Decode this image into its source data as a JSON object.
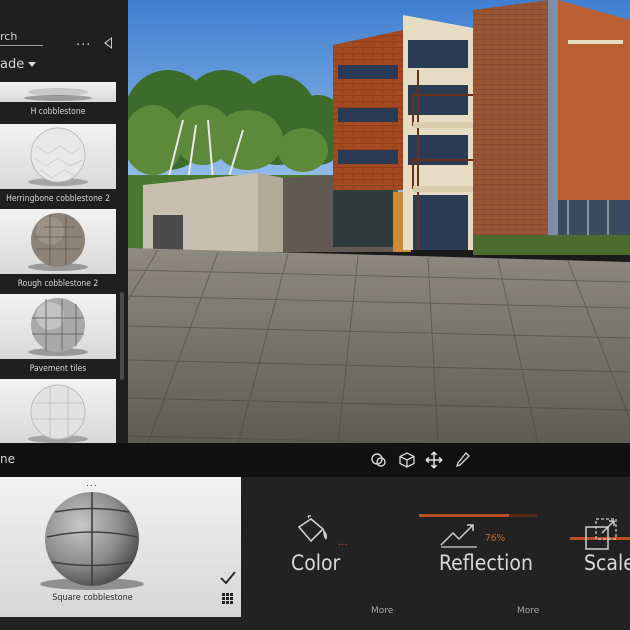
{
  "library": {
    "search_label": "rch",
    "more_label": "...",
    "category_label": "ade",
    "materials": [
      {
        "name": "H cobblestone"
      },
      {
        "name": "Herringbone cobblestone 2"
      },
      {
        "name": "Rough cobblestone 2"
      },
      {
        "name": "Pavement tiles"
      },
      {
        "name": ""
      }
    ]
  },
  "toolbar": {
    "selected_name": "ne"
  },
  "selected_material": {
    "name": "Square cobblestone",
    "more_label": "..."
  },
  "properties": {
    "color": {
      "label": "Color",
      "more": "More",
      "ellipsis": "..."
    },
    "reflection": {
      "label": "Reflection",
      "value_label": "76%",
      "value": 76,
      "more": "More"
    },
    "scale": {
      "label": "Scale"
    }
  },
  "colors": {
    "accent": "#b84f22",
    "panel": "#1f1f1f",
    "toolbar": "#111111"
  },
  "icons": [
    "rotate-icon",
    "cube-icon",
    "move-icon",
    "eyedropper-icon",
    "paint-bucket-icon",
    "reflection-icon",
    "scale-icon",
    "checkmark-icon",
    "grid-icon",
    "collapse-arrow-icon"
  ]
}
